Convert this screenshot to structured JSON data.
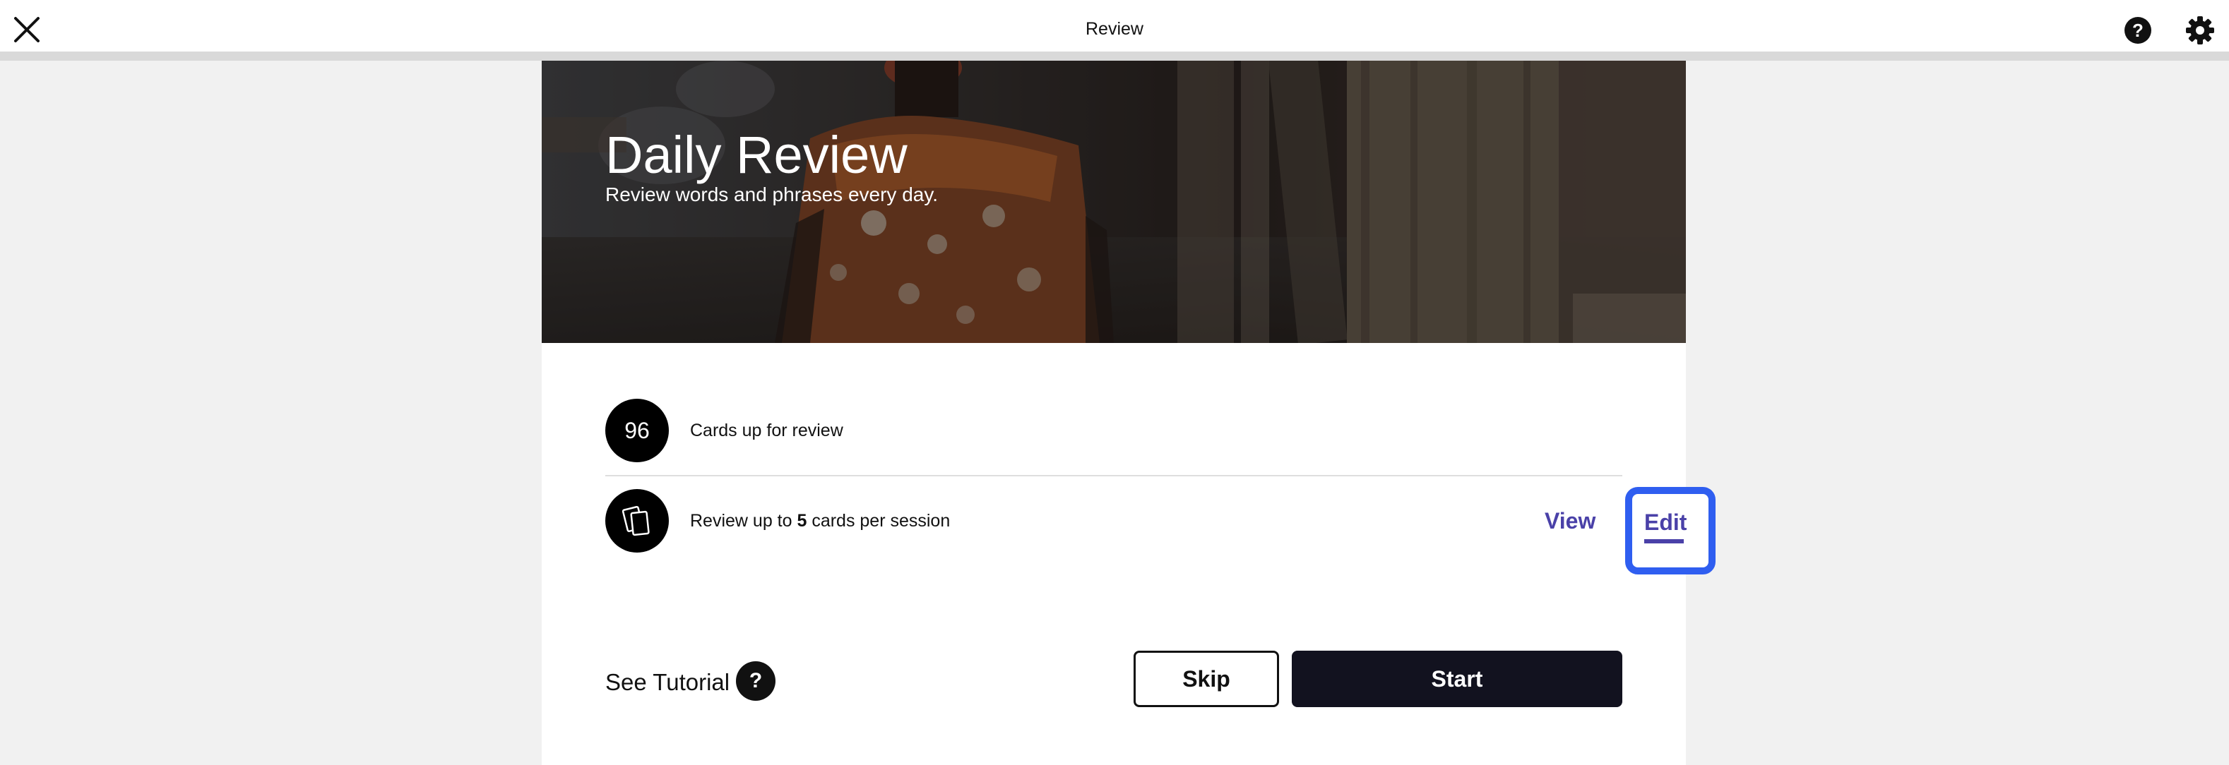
{
  "topbar": {
    "title": "Review",
    "close_icon": "close-icon",
    "help_icon": "question-circle-icon",
    "help_glyph": "?",
    "settings_icon": "gear-icon"
  },
  "hero": {
    "title": "Daily Review",
    "subtitle": "Review words and phrases every day."
  },
  "rows": {
    "cards_due": {
      "count": "96",
      "label": "Cards up for review"
    },
    "session": {
      "icon": "cards-icon",
      "text_before": "Review up to ",
      "count": "5",
      "text_after": " cards per session",
      "view_label": "View",
      "edit_label": "Edit"
    }
  },
  "footer": {
    "tutorial_label": "See Tutorial",
    "tutorial_icon": "question-circle-icon",
    "tutorial_glyph": "?",
    "skip_label": "Skip",
    "start_label": "Start"
  },
  "colors": {
    "accent": "#4a41a8",
    "focus_ring": "#2f5ef0",
    "primary_button": "#12121f"
  }
}
